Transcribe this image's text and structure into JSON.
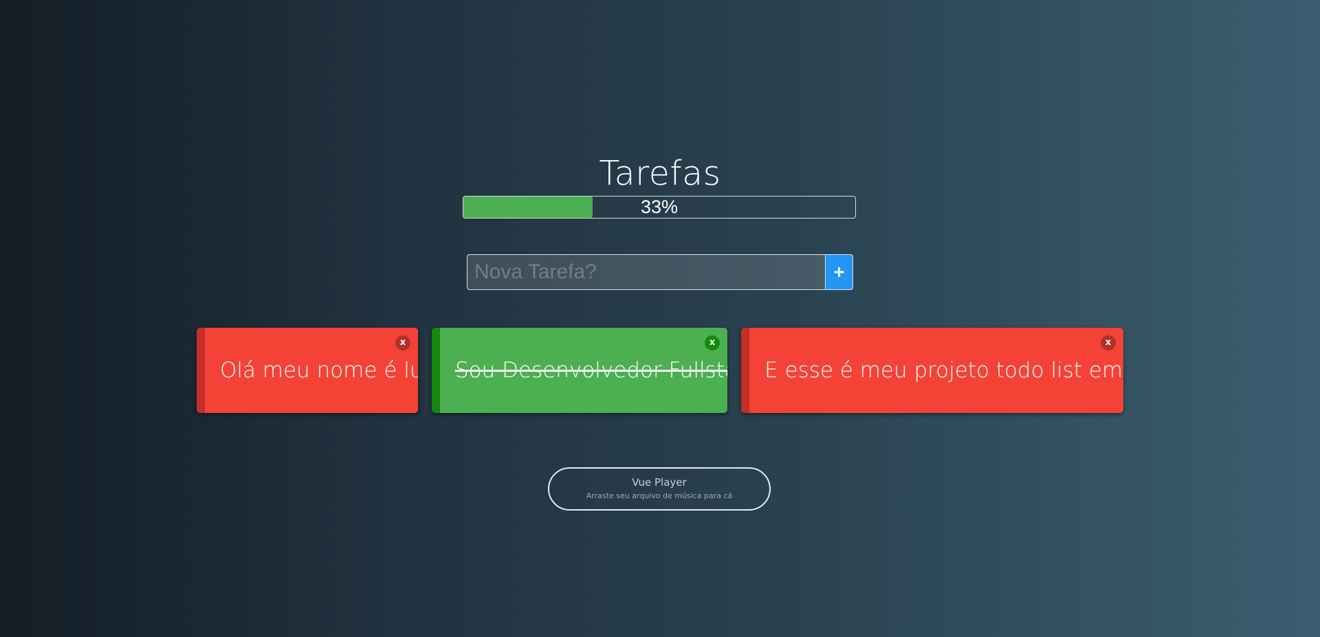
{
  "header": {
    "title": "Tarefas"
  },
  "progress": {
    "percent": 33,
    "label": "33%",
    "color": "#4caf50"
  },
  "new_task": {
    "placeholder": "Nova Tarefa?",
    "value": "",
    "add_label": "+"
  },
  "tasks": [
    {
      "text": "Olá meu nome é luan.",
      "done": false,
      "close_label": "x"
    },
    {
      "text": "Sou Desenvolvedor Fullstack.",
      "done": true,
      "close_label": "x"
    },
    {
      "text": "E esse é meu projeto todo list em Vuejs",
      "done": false,
      "close_label": "x"
    }
  ],
  "player": {
    "title": "Vue Player",
    "subtitle": "Arraste seu arquivo de música para cá"
  },
  "colors": {
    "pending": "#f44336",
    "done": "#4caf50",
    "accent": "#2196f3"
  }
}
